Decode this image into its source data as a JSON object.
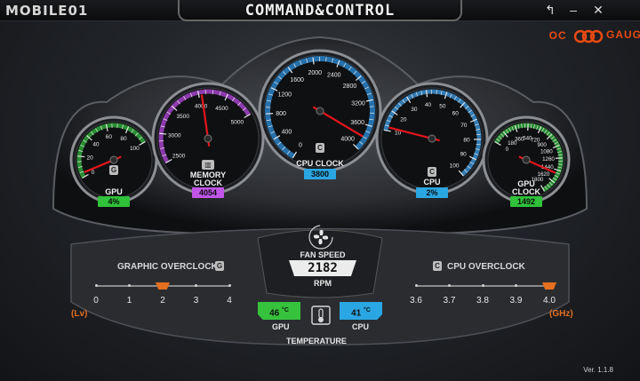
{
  "window": {
    "brand": "MOBILE01",
    "title": "COMMAND&CONTROL",
    "back_glyph": "↰",
    "min_glyph": "–",
    "close_glyph": "✕"
  },
  "logo": {
    "left": "OC",
    "right": "GAUGE",
    "color": "#e84a12"
  },
  "gauges": {
    "gpu": {
      "label": "GPU",
      "value": "4%",
      "value_bg": "#2fc23a",
      "value_fraction": 0.04,
      "ticks": [
        "0",
        "20",
        "40",
        "60",
        "80",
        "100"
      ],
      "arc_color": "#2fa63a"
    },
    "memory": {
      "label1": "MEMORY",
      "label2": "CLOCK",
      "value": "4054",
      "value_bg": "#c055e8",
      "ticks": [
        "2500",
        "3000",
        "3500",
        "4000",
        "4500",
        "5000"
      ],
      "arc_color": "#a243c8",
      "min": 2500,
      "max": 5000,
      "reading": 4054
    },
    "cpu_clock": {
      "label": "CPU CLOCK",
      "value": "3800",
      "value_bg": "#2aa6e3",
      "ticks": [
        "0",
        "400",
        "800",
        "1200",
        "1600",
        "2000",
        "2400",
        "2800",
        "3200",
        "3600",
        "4000"
      ],
      "arc_color": "#2a83c8",
      "min": 0,
      "max": 4000,
      "reading": 3800
    },
    "cpu": {
      "label": "CPU",
      "value": "2%",
      "value_bg": "#2aa6e3",
      "value_fraction": 0.02,
      "ticks": [
        "10",
        "20",
        "30",
        "40",
        "50",
        "60",
        "70",
        "80",
        "90",
        "100"
      ],
      "arc_color": "#3b8fd1"
    },
    "gpu_clock": {
      "label1": "GPU",
      "label2": "CLOCK",
      "value": "1492",
      "value_bg": "#2fc23a",
      "ticks": [
        "0",
        "180",
        "360",
        "540",
        "720",
        "900",
        "1080",
        "1260",
        "1440",
        "1620",
        "1800"
      ],
      "arc_color": "#2fa63a",
      "min": 0,
      "max": 1800,
      "reading": 1492
    }
  },
  "graphic_oc": {
    "title": "GRAPHIC OVERCLOCK",
    "unit": "(Lv)",
    "levels": [
      "0",
      "1",
      "2",
      "3",
      "4"
    ],
    "selected_index": 2
  },
  "cpu_oc": {
    "title": "CPU OVERCLOCK",
    "unit": "(GHz)",
    "levels": [
      "3.6",
      "3.7",
      "3.8",
      "3.9",
      "4.0"
    ],
    "selected_index": 4
  },
  "fan": {
    "label": "FAN SPEED",
    "value": "2182",
    "unit": "RPM"
  },
  "temperature": {
    "label": "TEMPERATURE",
    "gpu": {
      "label": "GPU",
      "value": "46",
      "unit": "°C",
      "color": "#36c23c"
    },
    "cpu": {
      "label": "CPU",
      "value": "41",
      "unit": "°C",
      "color": "#2aa6e3"
    }
  },
  "version": "Ver. 1.1.8"
}
